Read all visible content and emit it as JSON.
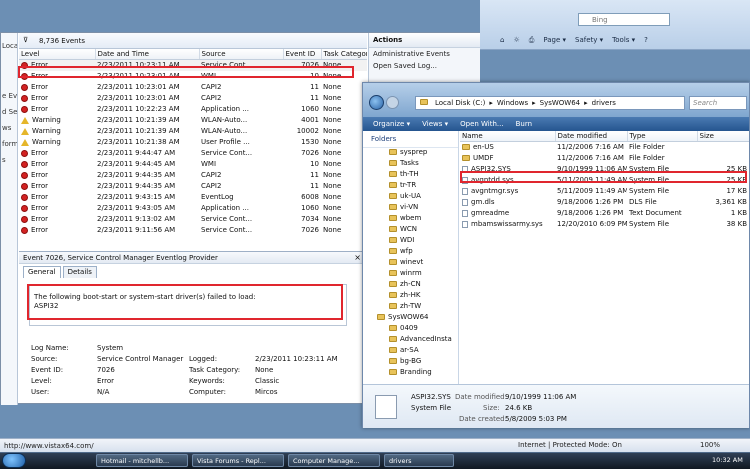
{
  "ie": {
    "search_placeholder": "Bing",
    "commands": [
      "Page ▾",
      "Safety ▾",
      "Tools ▾"
    ],
    "status_url": "http://www.vistax64.com/",
    "zone": "Internet | Protected Mode: On",
    "zoom": "100%"
  },
  "event_viewer": {
    "left_pane": [
      "Local",
      "e Ev",
      "d Se",
      "ws",
      "forma",
      "s"
    ],
    "event_count": "8,736 Events",
    "columns": [
      "Level",
      "Date and Time",
      "Source",
      "Event ID",
      "Task Category"
    ],
    "rows": [
      {
        "level": "Error",
        "type": "error",
        "date": "2/23/2011 10:23:11 AM",
        "source": "Service Cont...",
        "id": "7026",
        "task": "None"
      },
      {
        "level": "Error",
        "type": "error",
        "date": "2/23/2011 10:23:01 AM",
        "source": "WMI",
        "id": "10",
        "task": "None"
      },
      {
        "level": "Error",
        "type": "error",
        "date": "2/23/2011 10:23:01 AM",
        "source": "CAPI2",
        "id": "11",
        "task": "None"
      },
      {
        "level": "Error",
        "type": "error",
        "date": "2/23/2011 10:23:01 AM",
        "source": "CAPI2",
        "id": "11",
        "task": "None"
      },
      {
        "level": "Error",
        "type": "error",
        "date": "2/23/2011 10:22:23 AM",
        "source": "Application ...",
        "id": "1060",
        "task": "None"
      },
      {
        "level": "Warning",
        "type": "warn",
        "date": "2/23/2011 10:21:39 AM",
        "source": "WLAN-Auto...",
        "id": "4001",
        "task": "None"
      },
      {
        "level": "Warning",
        "type": "warn",
        "date": "2/23/2011 10:21:39 AM",
        "source": "WLAN-Auto...",
        "id": "10002",
        "task": "None"
      },
      {
        "level": "Warning",
        "type": "warn",
        "date": "2/23/2011 10:21:38 AM",
        "source": "User Profile ...",
        "id": "1530",
        "task": "None"
      },
      {
        "level": "Error",
        "type": "error",
        "date": "2/23/2011 9:44:47 AM",
        "source": "Service Cont...",
        "id": "7026",
        "task": "None"
      },
      {
        "level": "Error",
        "type": "error",
        "date": "2/23/2011 9:44:45 AM",
        "source": "WMI",
        "id": "10",
        "task": "None"
      },
      {
        "level": "Error",
        "type": "error",
        "date": "2/23/2011 9:44:35 AM",
        "source": "CAPI2",
        "id": "11",
        "task": "None"
      },
      {
        "level": "Error",
        "type": "error",
        "date": "2/23/2011 9:44:35 AM",
        "source": "CAPI2",
        "id": "11",
        "task": "None"
      },
      {
        "level": "Error",
        "type": "error",
        "date": "2/23/2011 9:43:15 AM",
        "source": "EventLog",
        "id": "6008",
        "task": "None"
      },
      {
        "level": "Error",
        "type": "error",
        "date": "2/23/2011 9:43:05 AM",
        "source": "Application ...",
        "id": "1060",
        "task": "None"
      },
      {
        "level": "Error",
        "type": "error",
        "date": "2/23/2011 9:13:02 AM",
        "source": "Service Cont...",
        "id": "7034",
        "task": "None"
      },
      {
        "level": "Error",
        "type": "error",
        "date": "2/23/2011 9:11:56 AM",
        "source": "Service Cont...",
        "id": "7026",
        "task": "None"
      }
    ],
    "actions": {
      "title": "Actions",
      "items": [
        "Administrative Events",
        "Open Saved Log..."
      ]
    },
    "detail": {
      "title": "Event 7026, Service Control Manager Eventlog Provider",
      "tabs": [
        "General",
        "Details"
      ],
      "message_line1": "The following boot-start or system-start driver(s) failed to load:",
      "message_line2": "ASPI32",
      "log_name_label": "Log Name:",
      "log_name": "System",
      "source_label": "Source:",
      "source": "Service Control Manager Eve",
      "logged_label": "Logged:",
      "logged": "2/23/2011 10:23:11 AM",
      "event_id_label": "Event ID:",
      "event_id": "7026",
      "task_label": "Task Category:",
      "task": "None",
      "level_label": "Level:",
      "level": "Error",
      "keywords_label": "Keywords:",
      "keywords": "Classic",
      "user_label": "User:",
      "user": "N/A",
      "computer_label": "Computer:",
      "computer": "Mircos"
    }
  },
  "explorer": {
    "breadcrumb": [
      "Local Disk (C:)",
      "Windows",
      "SysWOW64",
      "drivers"
    ],
    "search_placeholder": "Search",
    "toolbar": [
      "Organize ▾",
      "Views ▾",
      "Open With...",
      "Burn"
    ],
    "nav_title": "Folders",
    "nav_items": [
      "sysprep",
      "Tasks",
      "th-TH",
      "tr-TR",
      "uk-UA",
      "vi-VN",
      "wbem",
      "WCN",
      "WDI",
      "wfp",
      "winevt",
      "winrm",
      "zh-CN",
      "zh-HK",
      "zh-TW",
      "SysWOW64",
      "0409",
      "AdvancedInsta",
      "ar-SA",
      "bg-BG",
      "Branding"
    ],
    "columns": [
      "Name",
      "Date modified",
      "Type",
      "Size"
    ],
    "files": [
      {
        "name": "en-US",
        "date": "11/2/2006 7:16 AM",
        "type": "File Folder",
        "size": "",
        "folder": true
      },
      {
        "name": "UMDF",
        "date": "11/2/2006 7:16 AM",
        "type": "File Folder",
        "size": "",
        "folder": true
      },
      {
        "name": "ASPI32.SYS",
        "date": "9/10/1999 11:06 AM",
        "type": "System File",
        "size": "25 KB",
        "folder": false
      },
      {
        "name": "avgntdd.sys",
        "date": "5/11/2009 11:49 AM",
        "type": "System File",
        "size": "25 KB",
        "folder": false
      },
      {
        "name": "avgntmgr.sys",
        "date": "5/11/2009 11:49 AM",
        "type": "System File",
        "size": "17 KB",
        "folder": false
      },
      {
        "name": "gm.dls",
        "date": "9/18/2006 1:26 PM",
        "type": "DLS File",
        "size": "3,361 KB",
        "folder": false
      },
      {
        "name": "gmreadme",
        "date": "9/18/2006 1:26 PM",
        "type": "Text Document",
        "size": "1 KB",
        "folder": false
      },
      {
        "name": "mbamswissarmy.sys",
        "date": "12/20/2010 6:09 PM",
        "type": "System File",
        "size": "38 KB",
        "folder": false
      }
    ],
    "details": {
      "name": "ASPI32.SYS",
      "date_label": "Date modified:",
      "date": "9/10/1999 11:06 AM",
      "type": "System File",
      "size_label": "Size:",
      "size": "24.6 KB",
      "created_label": "Date created:",
      "created": "5/8/2009 5:03 PM"
    }
  },
  "taskbar": {
    "buttons": [
      "Hotmail - mitchellb...",
      "Vista Forums - Repl...",
      "Computer Manage...",
      "drivers"
    ],
    "clock": "10:32 AM"
  }
}
